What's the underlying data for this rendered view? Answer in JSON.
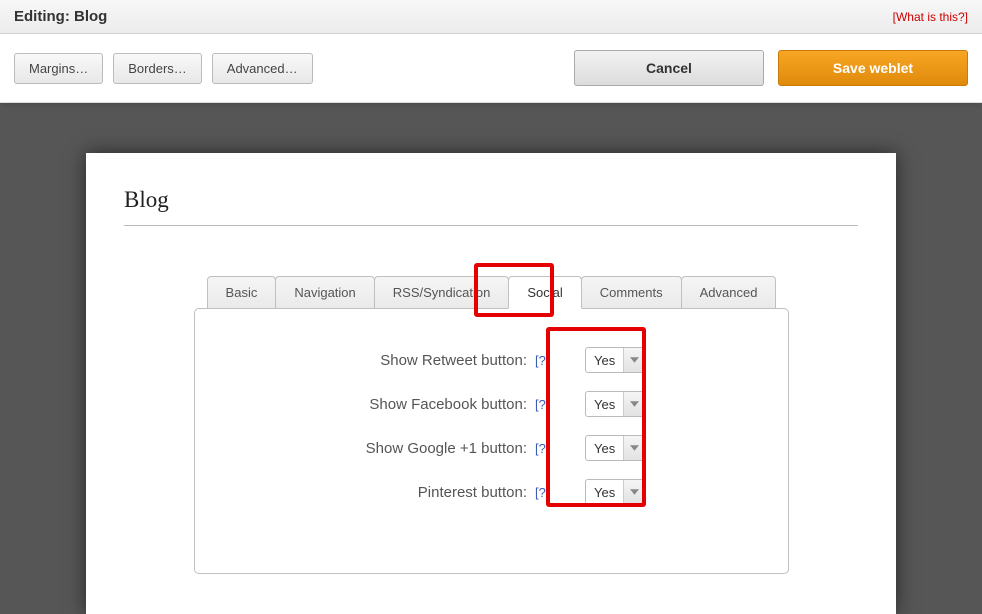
{
  "header": {
    "title": "Editing: Blog",
    "what_is_this": "[What is this?]"
  },
  "toolbar": {
    "margins": "Margins…",
    "borders": "Borders…",
    "advanced": "Advanced…",
    "cancel": "Cancel",
    "save": "Save weblet"
  },
  "panel": {
    "title": "Blog"
  },
  "tabs": {
    "basic": "Basic",
    "navigation": "Navigation",
    "rss": "RSS/Syndication",
    "social": "Social",
    "comments": "Comments",
    "advanced": "Advanced"
  },
  "fields": {
    "retweet": {
      "label": "Show Retweet button:",
      "help": "[?]",
      "value": "Yes"
    },
    "facebook": {
      "label": "Show Facebook button:",
      "help": "[?]",
      "value": "Yes"
    },
    "google": {
      "label": "Show Google +1 button:",
      "help": "[?]",
      "value": "Yes"
    },
    "pinterest": {
      "label": "Pinterest button:",
      "help": "[?]",
      "value": "Yes"
    }
  }
}
